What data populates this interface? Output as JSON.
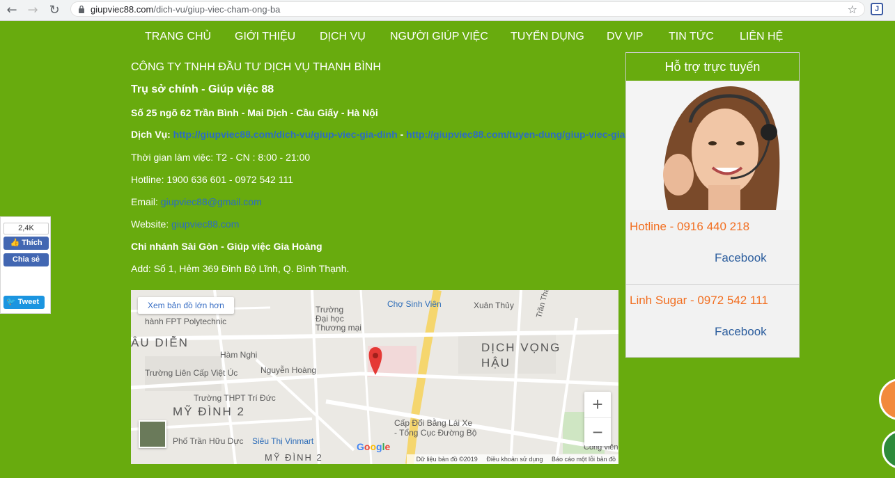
{
  "browser": {
    "url_host": "giupviec88.com",
    "url_path": "/dich-vu/giup-viec-cham-ong-ba",
    "extension_label": "J"
  },
  "nav": [
    "TRANG CHỦ",
    "GIỚI THIỆU",
    "DỊCH VỤ",
    "NGƯỜI GIÚP VIỆC",
    "TUYỂN DỤNG",
    "DV VIP",
    "TIN TỨC",
    "LIÊN HỆ"
  ],
  "company": {
    "name": "CÔNG TY TNHH ĐẦU TƯ DỊCH VỤ THANH BÌNH",
    "head_office": "Trụ sở chính - Giúp việc 88",
    "address_1": "Số 25 ngõ 62 Trần Bình - Mai Dịch - Cầu Giấy - Hà Nội",
    "services_label": "Dịch Vụ:",
    "service_link_1": "http://giupviec88.com/dich-vu/giup-viec-gia-dinh",
    "services_sep": " - ",
    "service_link_2": "http://giupviec88.com/tuyen-dung/giup-viec-gia",
    "hours": "Thời gian làm việc: T2 - CN : 8:00 - 21:00",
    "hotline": "Hotline: 1900 636 601 - 0972 542 111",
    "email_label": "Email:",
    "email": "giupviec88@gmail.com",
    "website_label": "Website:",
    "website": "giupviec88.com",
    "branch": "Chi nhánh Sài Gòn - Giúp việc Gia Hoàng",
    "address_2": "Add: Số 1, Hẻm 369 Đinh Bộ Lĩnh, Q. Bình Thạnh."
  },
  "map": {
    "enlarge_link": "Xem bản đồ lớn hơn",
    "labels": {
      "fpt": "hành FPT Polytechnic",
      "dhtm": "Trường\nĐại học\nThương mại",
      "cho_sinh_vien": "Chợ Sinh Viên",
      "xuan_thuy": "Xuân Thủy",
      "au_dien": "ÂU DIỄN",
      "ham_nghi": "Hàm Nghi",
      "nguyen_hoang": "Nguyễn Hoàng",
      "lien_cap": "Trường Liên Cấp Việt Úc",
      "dich_vong_hau": "DỊCH VỌNG HẬU",
      "tran_thai_tong": "Trần Thái Tông",
      "thpt_tri_duc": "Trường THPT Trí Đức",
      "my_dinh_2": "MỸ ĐÌNH 2",
      "tran_huu_duc": "Phố Trần Hữu Dực",
      "vinmart": "Siêu Thị Vinmart",
      "cap_doi": "Cấp Đổi Bằng Lái Xe",
      "tong_cuc": "- Tổng Cục Đường Bộ",
      "my_dinh_2b": "MỸ ĐÌNH 2",
      "cong_vien": "Công viên"
    },
    "google": "Google",
    "footer_data": "Dữ liệu bản đồ ©2019",
    "footer_terms": "Điều khoản sử dụng",
    "footer_report": "Báo cáo một lỗi bản đồ",
    "zoom_in": "+",
    "zoom_out": "−"
  },
  "support": {
    "title": "Hỗ trợ trực tuyến",
    "contacts": [
      {
        "name": "Hotline - 0916 440 218",
        "facebook": "Facebook"
      },
      {
        "name": "Linh Sugar - 0972 542 111",
        "facebook": "Facebook"
      }
    ]
  },
  "social": {
    "like_count": "2,4K",
    "like": "Thích",
    "share": "Chia sẻ",
    "tweet": "Tweet"
  },
  "colors": {
    "page_green": "#68ab0e",
    "link_blue": "#2b6cc4",
    "contact_orange": "#f26f21",
    "facebook_blue": "#4267b2",
    "twitter_blue": "#1b95e0"
  }
}
